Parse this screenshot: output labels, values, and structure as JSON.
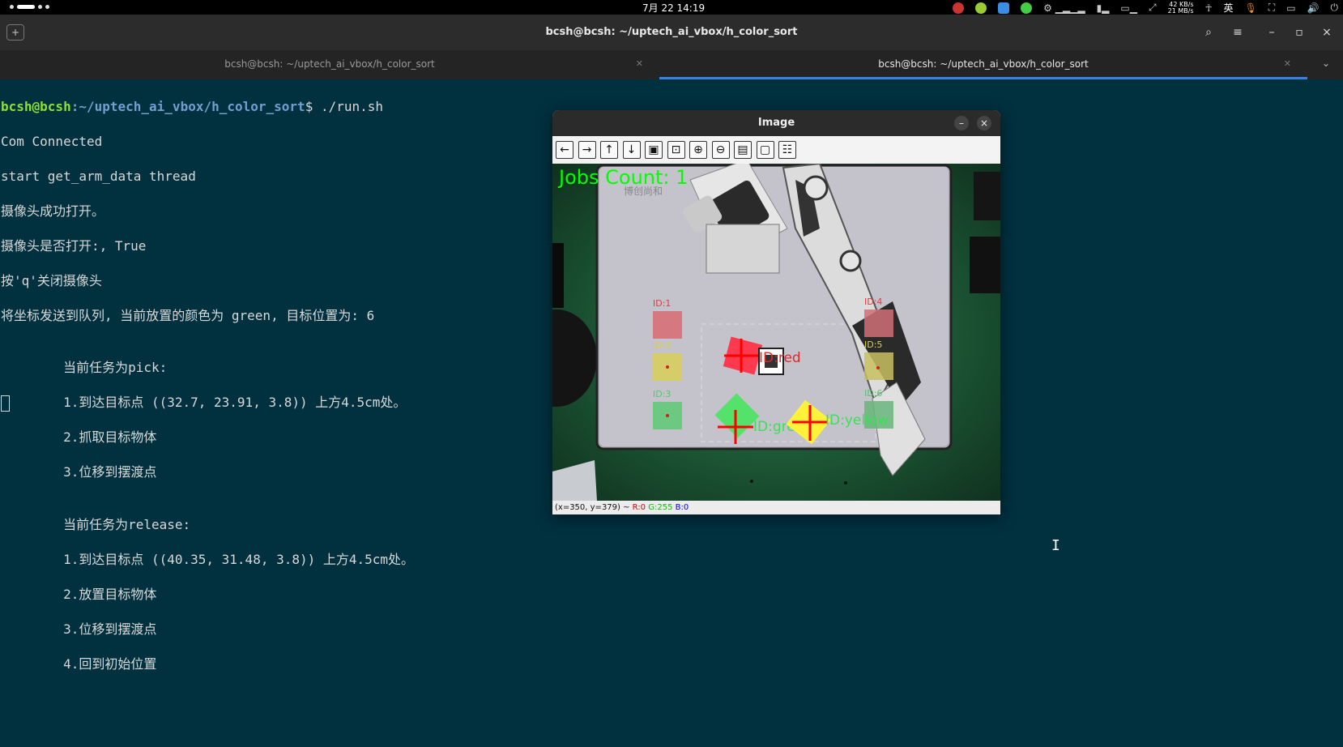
{
  "system_bar": {
    "clock": "7月 22  14:19",
    "net_up": "42 KB/s",
    "net_down": "21 MB/s",
    "ime": "英"
  },
  "terminal": {
    "window_title": "bcsh@bcsh: ~/uptech_ai_vbox/h_color_sort",
    "tabs": [
      {
        "label": "bcsh@bcsh: ~/uptech_ai_vbox/h_color_sort"
      },
      {
        "label": "bcsh@bcsh: ~/uptech_ai_vbox/h_color_sort"
      }
    ],
    "prompt_user": "bcsh@bcsh",
    "prompt_path": ":~/uptech_ai_vbox/h_color_sort",
    "prompt_cmd": "$ ./run.sh",
    "lines": [
      "Com Connected",
      "start get_arm_data thread",
      "摄像头成功打开。",
      "摄像头是否打开:, True",
      "按'q'关闭摄像头",
      "将坐标发送到队列, 当前放置的颜色为 green, 目标位置为: 6",
      "",
      "        当前任务为pick:",
      "        1.到达目标点 ((32.7, 23.91, 3.8)) 上方4.5cm处。",
      "        2.抓取目标物体",
      "        3.位移到摆渡点",
      "",
      "        当前任务为release:",
      "        1.到达目标点 ((40.35, 31.48, 3.8)) 上方4.5cm处。",
      "        2.放置目标物体",
      "        3.位移到摆渡点",
      "        4.回到初始位置"
    ]
  },
  "image_window": {
    "title": "Image",
    "toolbar_icons": [
      "arrow-left-icon",
      "arrow-right-icon",
      "arrow-up-icon",
      "arrow-down-icon",
      "zoom-fit-icon",
      "zoom-original-icon",
      "zoom-in-icon",
      "zoom-out-icon",
      "save-icon",
      "copy-icon",
      "properties-icon"
    ],
    "overlay": {
      "jobs_count": "Jobs Count: 1",
      "ids": [
        "ID:1",
        "ID:2",
        "ID:3",
        "ID:4",
        "ID:5",
        "ID:6"
      ],
      "labels": [
        "ID:red",
        "ID:green",
        "ID:yellow"
      ]
    },
    "status": {
      "coords": "(x=350, y=379) ~ ",
      "r": "R:0",
      "g": "G:255",
      "b": "B:0"
    }
  }
}
